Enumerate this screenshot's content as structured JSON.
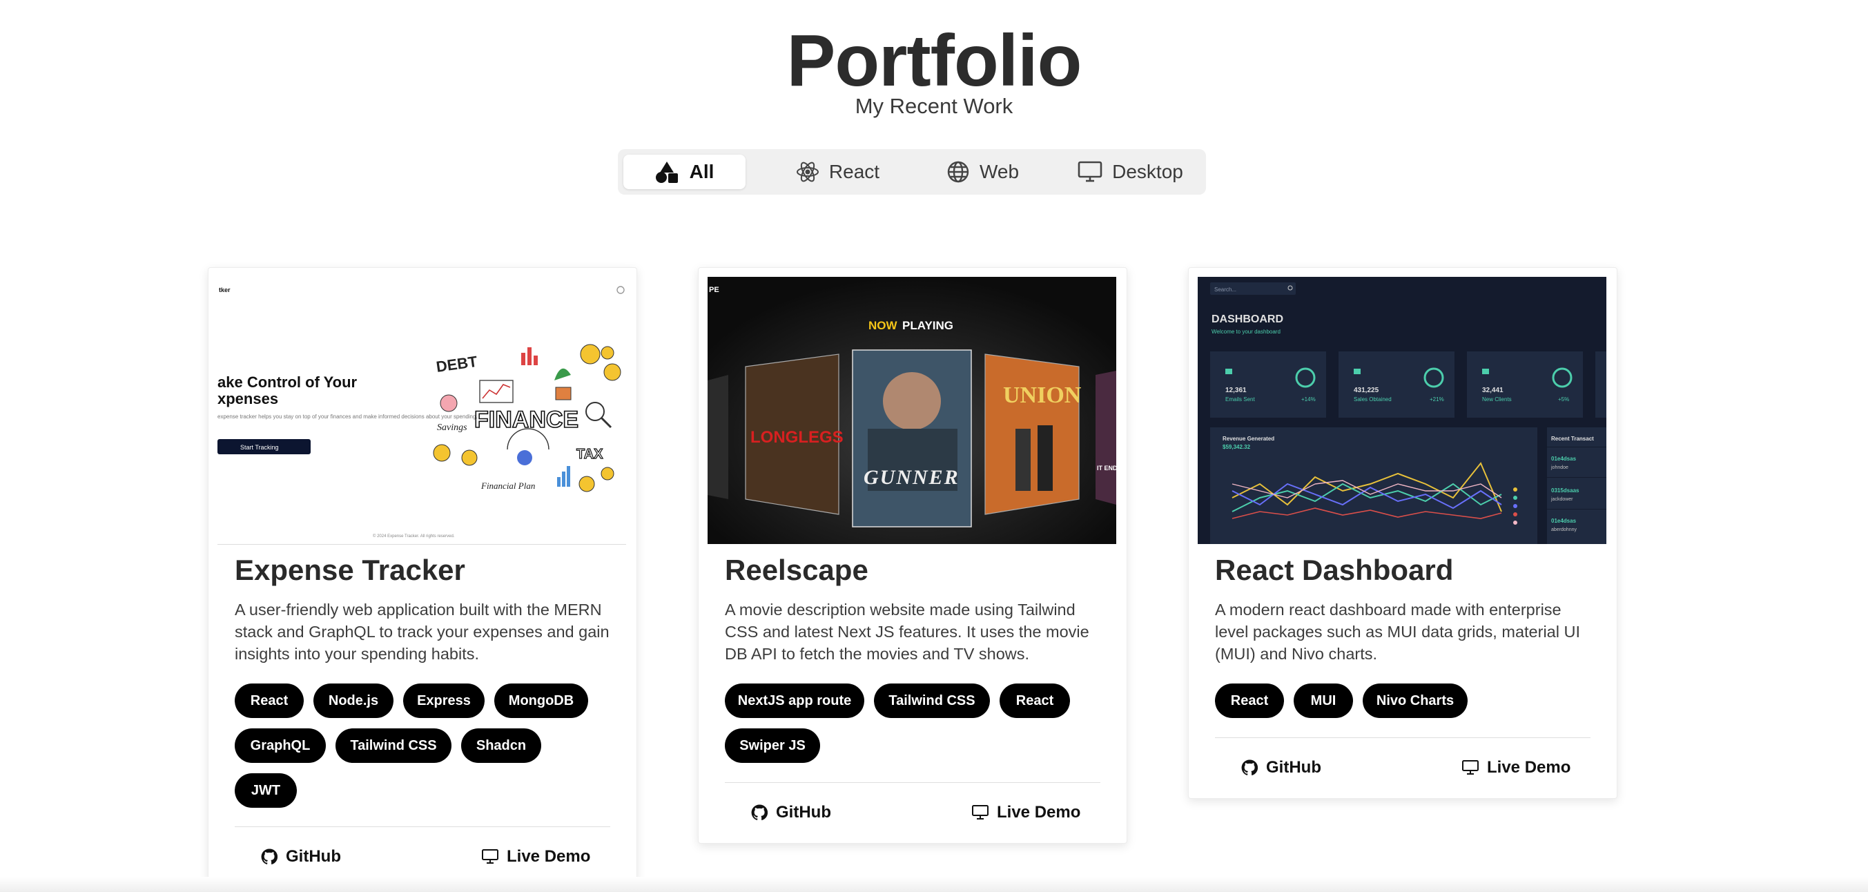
{
  "header": {
    "title": "Portfolio",
    "subtitle": "My Recent Work"
  },
  "filters": [
    {
      "label": "All",
      "icon": "shapes-icon",
      "active": true
    },
    {
      "label": "React",
      "icon": "react-icon",
      "active": false
    },
    {
      "label": "Web",
      "icon": "globe-icon",
      "active": false
    },
    {
      "label": "Desktop",
      "icon": "monitor-icon",
      "active": false
    }
  ],
  "projects": [
    {
      "title": "Expense Tracker",
      "description": "A user-friendly web application built with the MERN stack and GraphQL to track your expenses and gain insights into your spending habits.",
      "tags": [
        "React",
        "Node.js",
        "Express",
        "MongoDB",
        "GraphQL",
        "Tailwind CSS",
        "Shadcn",
        "JWT"
      ],
      "github_label": "GitHub",
      "demo_label": "Live Demo",
      "preview": {
        "logo": "tker",
        "hero_line1": "ake Control of Your",
        "hero_line2": "xpenses",
        "hero_text": "expense tracker helps you stay on top of your finances and make informed decisions about your spending.",
        "cta": "Start Tracking",
        "words": {
          "debt": "DEBT",
          "finance": "FINANCE",
          "tax": "TAX",
          "savings": "Savings",
          "plan": "Financial Plan"
        },
        "footer": "© 2024 Expense Tracker. All rights reserved."
      }
    },
    {
      "title": "Reelscape",
      "description": "A movie description website made using Tailwind CSS and latest Next JS features. It uses the movie DB API to fetch the movies and TV shows.",
      "tags": [
        "NextJS app route",
        "Tailwind CSS",
        "React",
        "Swiper JS"
      ],
      "github_label": "GitHub",
      "demo_label": "Live Demo",
      "preview": {
        "logo": "PE",
        "now": "NOW",
        "playing": "PLAYING",
        "posters": [
          "LONGLEGS",
          "GUNNER",
          "UNION",
          "IT ENDS WITH US"
        ]
      }
    },
    {
      "title": "React Dashboard",
      "description": "A modern react dashboard made with enterprise level packages such as MUI data grids, material UI (MUI) and Nivo charts.",
      "tags": [
        "React",
        "MUI",
        "Nivo Charts"
      ],
      "github_label": "GitHub",
      "demo_label": "Live Demo",
      "preview": {
        "search": "Search...",
        "heading": "DASHBOARD",
        "welcome": "Welcome to your dashboard",
        "stats": [
          {
            "value": "12,361",
            "label": "Emails Sent",
            "delta": "+14%"
          },
          {
            "value": "431,225",
            "label": "Sales Obtained",
            "delta": "+21%"
          },
          {
            "value": "32,441",
            "label": "New Clients",
            "delta": "+5%"
          }
        ],
        "revenue_label": "Revenue Generated",
        "revenue_value": "$59,342.32",
        "recent_label": "Recent Transact",
        "transactions": [
          {
            "id": "01e4dsas",
            "user": "johndoe"
          },
          {
            "id": "0315dsaas",
            "user": "jackdower"
          },
          {
            "id": "01e4dsas",
            "user": "aberdohnny"
          }
        ]
      }
    }
  ]
}
